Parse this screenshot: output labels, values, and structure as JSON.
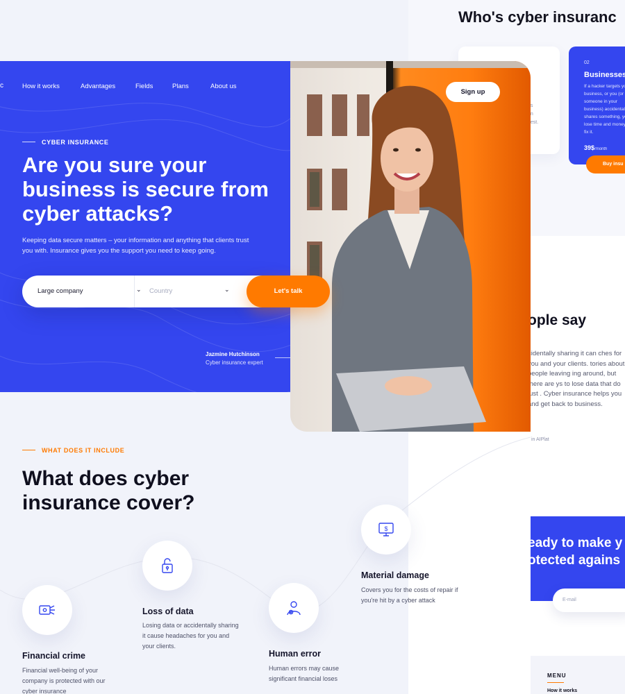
{
  "background_page": {
    "who_title": "Who's cyber insuranc",
    "grey_card_text": "y\n t\ngs\nan\nbest.",
    "blue_card": {
      "number": "02",
      "title": "Businesses",
      "text": "If a hacker targets your business, or you (or someone in your business) accidentally shares something, you lose time and money to fix it.",
      "price": "39$",
      "price_unit": "/month"
    },
    "buy_label": "Buy insu",
    "people_title": "ople say",
    "people_text": "cidentally sharing it can ches for you and your clients. tories about people leaving ing around, but there are ys to lose data that do just . Cyber insurance helps you and get back to business.",
    "people_note": "in AIPlat",
    "cta_title_1": "eady to make y",
    "cta_title_2": "otected agains",
    "email_placeholder": "E-mail",
    "footer_menu": "MENU",
    "footer_item": "How it works"
  },
  "header": {
    "logo_fragment": "c",
    "nav": [
      "How it works",
      "Advantages",
      "Fields",
      "Plans",
      "About us"
    ],
    "signup_label": "Sign up"
  },
  "hero": {
    "eyebrow": "CYBER INSURANCE",
    "title": "Are you sure your business is secure from cyber attacks?",
    "subtitle": "Keeping data secure matters – your information and anything that clients trust you with. Insurance gives you the support you need to keep going.",
    "search": {
      "company_value": "Large company",
      "country_placeholder": "Country",
      "cta_label": "Let's talk"
    },
    "expert_name": "Jazmine Hutchinson",
    "expert_role": "Cyber insurance expert"
  },
  "coverage": {
    "eyebrow": "WHAT DOES IT INCLUDE",
    "title": "What does cyber insurance cover?",
    "items": [
      {
        "title": "Financial crime",
        "text": "Financial well-being of your company is protected with our cyber insurance",
        "icon": "money-card-icon"
      },
      {
        "title": "Loss of data",
        "text": "Losing data or accidentally sharing it cause headaches for you and your clients.",
        "icon": "padlock-icon"
      },
      {
        "title": "Human error",
        "text": "Human errors may cause significant financial loses",
        "icon": "user-error-icon"
      },
      {
        "title": "Material damage",
        "text": "Covers you for the costs of repair if you're hit by a cyber attack",
        "icon": "monitor-dollar-icon"
      }
    ]
  },
  "colors": {
    "primary": "#3446ef",
    "accent": "#ff7a00",
    "text": "#0f0f1e"
  }
}
